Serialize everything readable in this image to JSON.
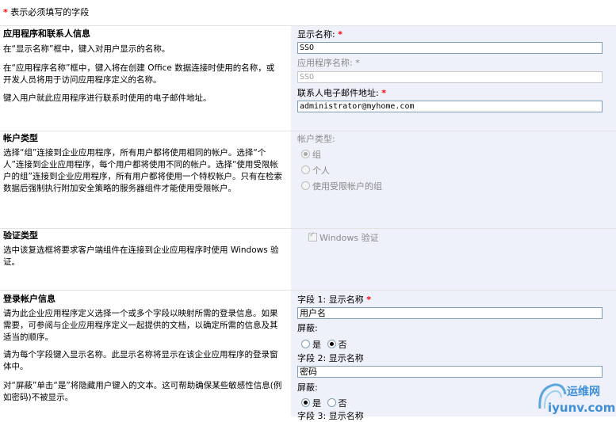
{
  "legend": {
    "star": "*",
    "text": "表示必须填写的字段"
  },
  "sections": {
    "app": {
      "title": "应用程序和联系人信息",
      "desc1": "在“显示名称”框中，键入对用户显示的名称。",
      "desc2": "在“应用程序名称”框中，键入将在创建 Office 数据连接时使用的名称，或开发人员将用于访问应用程序定义的名称。",
      "desc3": "键入用户就此应用程序进行联系时使用的电子邮件地址。",
      "display_name_label": "显示名称:",
      "display_name_value": "SSO",
      "app_name_label": "应用程序名称:",
      "app_name_value": "SSO",
      "email_label": "联系人电子邮件地址:",
      "email_value": "administrator@myhome.com"
    },
    "account": {
      "title": "帐户类型",
      "desc": "选择“组”连接到企业应用程序，所有用户都将使用相同的帐户。选择“个人”连接到企业应用程序，每个用户都将使用不同的帐户。选择“使用受限帐户的组”连接到企业应用程序，所有用户都将使用一个特权帐户。只有在检索数据后强制执行附加安全策略的服务器组件才能使用受限帐户。",
      "label": "帐户类型:",
      "opt_group": "组",
      "opt_individual": "个人",
      "opt_restricted": "使用受限帐户的组"
    },
    "auth": {
      "title": "验证类型",
      "desc": "选中该复选框将要求客户端组件在连接到企业应用程序时使用 Windows 验证。",
      "checkbox_label": "Windows 验证"
    },
    "logon": {
      "title": "登录帐户信息",
      "desc1": "请为此企业应用程序定义选择一个或多个字段以映射所需的登录信息。如果需要，可参阅与企业应用程序定义一起提供的文档，以确定所需的信息及其适当的顺序。",
      "desc2": "请为每个字段键入显示名称。此显示名称将显示在该企业应用程序的登录窗体中。",
      "desc3": "对“屏蔽”单击“是”将隐藏用户键入的文本。这可帮助确保某些敏感性信息(例如密码)不被显示。",
      "field1_label": "字段 1: 显示名称",
      "field1_value": "用户名",
      "mask_label": "屏蔽:",
      "yes": "是",
      "no": "否",
      "field2_label": "字段 2: 显示名称",
      "field2_value": "密码",
      "field3_label": "字段 3: 显示名称"
    }
  },
  "watermark": {
    "cn": "运维网",
    "url": "iyunv.com"
  }
}
